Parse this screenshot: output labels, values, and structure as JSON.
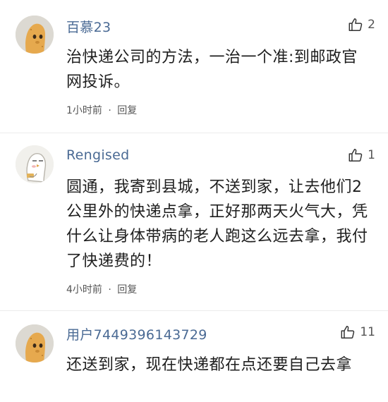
{
  "comments": [
    {
      "username": "百慕23",
      "likes": "2",
      "text": "治快递公司的方法，一治一个准:到邮政官网投诉。",
      "time": "1小时前",
      "separator": "·",
      "reply_label": "回复",
      "avatar": "potato-avatar"
    },
    {
      "username": "Rengised",
      "likes": "1",
      "text": "圆通，我寄到县城，不送到家，让去他们2公里外的快递点拿，正好那两天火气大，凭什么让身体带病的老人跑这么远去拿，我付了快递费的！",
      "time": "4小时前",
      "separator": "·",
      "reply_label": "回复",
      "avatar": "cartoon-bird-avatar"
    },
    {
      "username": "用户7449396143729",
      "likes": "11",
      "text": "还送到家，现在快递都在点还要自己去拿",
      "avatar": "potato-avatar"
    }
  ],
  "icons": {
    "like": "thumbs-up-icon"
  },
  "colors": {
    "username": "#4a6a94",
    "text": "#1e1e1e",
    "meta": "#555555"
  }
}
